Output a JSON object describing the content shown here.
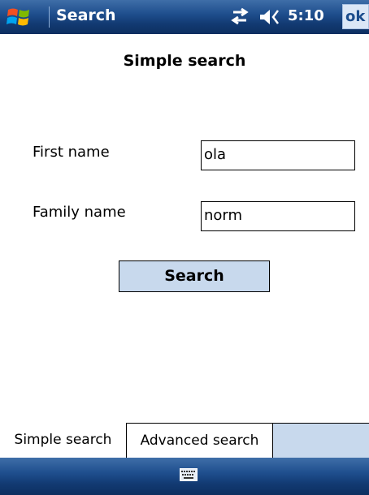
{
  "titlebar": {
    "app_title": "Search",
    "time": "5:10",
    "ok_label": "ok",
    "icons": [
      "windows-start-icon",
      "connectivity-icon",
      "volume-icon"
    ]
  },
  "page": {
    "title": "Simple search"
  },
  "form": {
    "first_name_label": "First name",
    "first_name_value": "ola",
    "family_name_label": "Family name",
    "family_name_value": "norm",
    "search_button_label": "Search"
  },
  "tabs": [
    {
      "label": "Simple search",
      "active": true
    },
    {
      "label": "Advanced search",
      "active": false
    }
  ],
  "bottombar": {
    "icons": [
      "keyboard-icon"
    ]
  },
  "colors": {
    "titlebar_blue": "#1f4f8e",
    "button_fill": "#c8d9ed",
    "tabstrip_fill": "#c8d9ed"
  }
}
